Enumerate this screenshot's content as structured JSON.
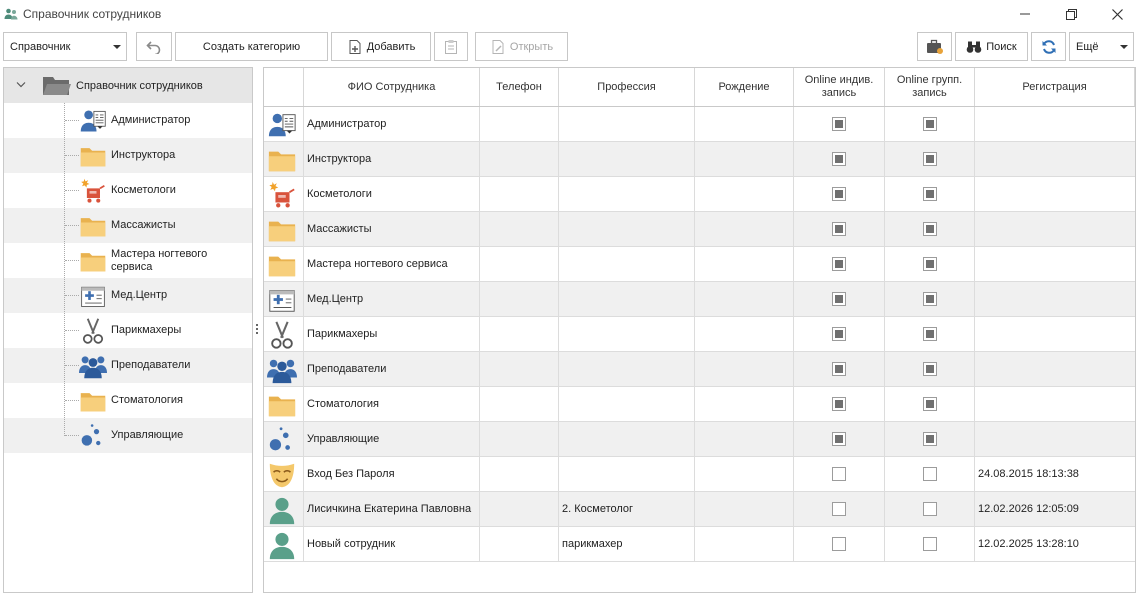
{
  "window": {
    "title": "Справочник сотрудников",
    "minimize_glyph": "—",
    "restore_glyph": "❐",
    "close_glyph": "✕"
  },
  "toolbar": {
    "combo_value": "Справочник",
    "create_category_label": "Создать категорию",
    "add_label": "Добавить",
    "open_label": "Открыть",
    "search_label": "Поиск",
    "more_label": "Ещё"
  },
  "tree": {
    "root_label": "Справочник сотрудников",
    "items": [
      {
        "label": "Администратор",
        "icon": "admin-icon"
      },
      {
        "label": "Инструктора",
        "icon": "folder-icon"
      },
      {
        "label": "Косметологи",
        "icon": "cosmetology-icon"
      },
      {
        "label": "Массажисты",
        "icon": "folder-icon"
      },
      {
        "label": "Мастера ногтевого сервиса",
        "icon": "folder-icon"
      },
      {
        "label": "Мед.Центр",
        "icon": "medical-icon"
      },
      {
        "label": "Парикмахеры",
        "icon": "scissors-icon"
      },
      {
        "label": "Преподаватели",
        "icon": "teachers-icon"
      },
      {
        "label": "Стоматология",
        "icon": "folder-icon"
      },
      {
        "label": "Управляющие",
        "icon": "bubbles-icon"
      }
    ]
  },
  "grid": {
    "columns": [
      "",
      "ФИО Сотрудника",
      "Телефон",
      "Профессия",
      "Рождение",
      "Online индив. запись",
      "Online групп. запись",
      "Регистрация"
    ],
    "rows": [
      {
        "name": "Администратор",
        "icon": "admin-icon",
        "phone": "",
        "profession": "",
        "birth": "",
        "indiv": "indeterminate",
        "group": "indeterminate",
        "registration": ""
      },
      {
        "name": "Инструктора",
        "icon": "folder-icon",
        "phone": "",
        "profession": "",
        "birth": "",
        "indiv": "indeterminate",
        "group": "indeterminate",
        "registration": ""
      },
      {
        "name": "Косметологи",
        "icon": "cosmetology-icon",
        "phone": "",
        "profession": "",
        "birth": "",
        "indiv": "indeterminate",
        "group": "indeterminate",
        "registration": ""
      },
      {
        "name": "Массажисты",
        "icon": "folder-icon",
        "phone": "",
        "profession": "",
        "birth": "",
        "indiv": "indeterminate",
        "group": "indeterminate",
        "registration": ""
      },
      {
        "name": "Мастера ногтевого сервиса",
        "icon": "folder-icon",
        "phone": "",
        "profession": "",
        "birth": "",
        "indiv": "indeterminate",
        "group": "indeterminate",
        "registration": ""
      },
      {
        "name": "Мед.Центр",
        "icon": "medical-icon",
        "phone": "",
        "profession": "",
        "birth": "",
        "indiv": "indeterminate",
        "group": "indeterminate",
        "registration": ""
      },
      {
        "name": "Парикмахеры",
        "icon": "scissors-icon",
        "phone": "",
        "profession": "",
        "birth": "",
        "indiv": "indeterminate",
        "group": "indeterminate",
        "registration": ""
      },
      {
        "name": "Преподаватели",
        "icon": "teachers-icon",
        "phone": "",
        "profession": "",
        "birth": "",
        "indiv": "indeterminate",
        "group": "indeterminate",
        "registration": ""
      },
      {
        "name": "Стоматология",
        "icon": "folder-icon",
        "phone": "",
        "profession": "",
        "birth": "",
        "indiv": "indeterminate",
        "group": "indeterminate",
        "registration": ""
      },
      {
        "name": "Управляющие",
        "icon": "bubbles-icon",
        "phone": "",
        "profession": "",
        "birth": "",
        "indiv": "indeterminate",
        "group": "indeterminate",
        "registration": ""
      },
      {
        "name": "Вход Без Пароля",
        "icon": "mask-icon",
        "phone": "",
        "profession": "",
        "birth": "",
        "indiv": "unchecked",
        "group": "unchecked",
        "registration": "24.08.2015 18:13:38"
      },
      {
        "name": "Лисичкина Екатерина Павловна",
        "icon": "person-icon",
        "phone": "",
        "profession": "2. Косметолог",
        "birth": "",
        "indiv": "unchecked",
        "group": "unchecked",
        "registration": "12.02.2026 12:05:09"
      },
      {
        "name": "Новый сотрудник",
        "icon": "person-icon",
        "phone": "",
        "profession": "парикмахер",
        "birth": "",
        "indiv": "unchecked",
        "group": "unchecked",
        "registration": "12.02.2025 13:28:10"
      }
    ]
  },
  "colors": {
    "folder": "#f5c46a",
    "blue": "#3f7cc4",
    "red": "#d9533c",
    "teal": "#5aa08a"
  }
}
